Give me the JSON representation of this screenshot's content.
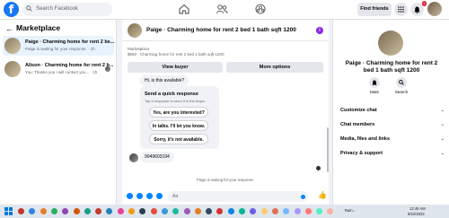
{
  "topbar": {
    "logo": "f",
    "search_placeholder": "Search Facebook",
    "find_friends_label": "Find friends",
    "notifications_count": "1"
  },
  "sidebar": {
    "title": "Marketplace",
    "back_glyph": "←",
    "chats": [
      {
        "name": "Paige · Charming home for rent 2 be...",
        "subtitle": "Paige is waiting for your response. · 1h"
      },
      {
        "name": "Alison · Charming home for rent 2 b...",
        "subtitle": "You: Thanks you I will contact you... · 1h"
      }
    ]
  },
  "chat": {
    "title": "Paige · Charming home for rent 2 bed 1 bath sqft 1200",
    "info_glyph": "i",
    "marketplace_label": "Marketplace",
    "listing_line": "$650 · Charming home for rent 2 bed 1 bath sqft 1200",
    "view_buyer_label": "View buyer",
    "more_options_label": "More options",
    "first_message": "Hi, is this available?",
    "quick_response_title": "Send a quick response",
    "quick_response_sub": "Tap a response to send it to the buyer.",
    "quick_options": [
      "Yes, are you interested?",
      "In talks. I'll let you know.",
      "Sorry, it's not available."
    ],
    "phone_message": "9049603194",
    "waiting_text": "Paige is waiting for your response.",
    "composer_placeholder": "Aa",
    "like_glyph": "👍"
  },
  "info_panel": {
    "title": "Paige · Charming home for rent 2 bed 1 bath sqft 1200",
    "mute_label": "Mute",
    "search_label": "Search",
    "sections": [
      "Customize chat",
      "Chat members",
      "Media, files and links",
      "Privacy & support"
    ]
  },
  "taskbar": {
    "weather": "Rain...",
    "time": "12:46 AM",
    "date": "8/22/2023"
  },
  "colors": {
    "accent": "#1877f2",
    "messenger_blue": "#0084ff",
    "active_chat": "#e7f3ff"
  }
}
